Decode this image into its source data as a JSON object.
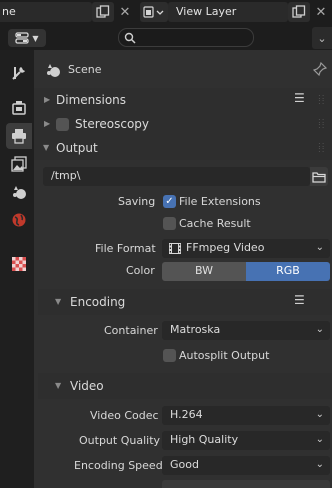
{
  "topbar": {
    "scene_field_text": "ne",
    "view_layer_label": "View Layer"
  },
  "header": {
    "search_placeholder": ""
  },
  "context": {
    "scene_label": "Scene"
  },
  "sections": {
    "dimensions": "Dimensions",
    "stereoscopy": "Stereoscopy",
    "output": "Output",
    "encoding": "Encoding",
    "video": "Video"
  },
  "output": {
    "path": "/tmp\\",
    "saving_label": "Saving",
    "file_extensions_label": "File Extensions",
    "file_extensions_checked": true,
    "cache_result_label": "Cache Result",
    "cache_result_checked": false,
    "file_format_label": "File Format",
    "file_format_value": "FFmpeg Video",
    "color_label": "Color",
    "color_options": [
      "BW",
      "RGB"
    ],
    "color_selected": "RGB"
  },
  "encoding": {
    "container_label": "Container",
    "container_value": "Matroska",
    "autosplit_label": "Autosplit Output",
    "autosplit_checked": false
  },
  "video": {
    "codec_label": "Video Codec",
    "codec_value": "H.264",
    "quality_label": "Output Quality",
    "quality_value": "High Quality",
    "speed_label": "Encoding Speed",
    "speed_value": "Good"
  },
  "colors": {
    "accent": "#4772b3",
    "panel_bg": "#303030",
    "field_bg": "#282828"
  }
}
